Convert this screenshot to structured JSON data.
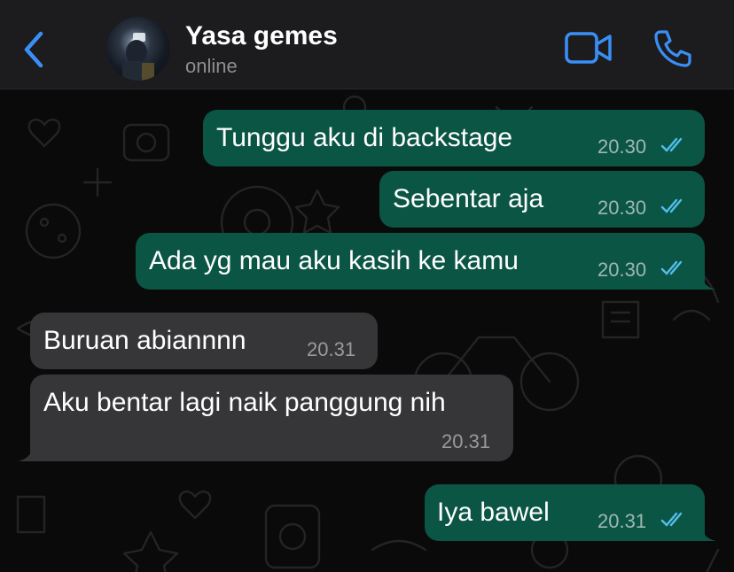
{
  "header": {
    "contact_name": "Yasa gemes",
    "status": "online",
    "back_icon": "chevron-left-icon",
    "video_icon": "video-camera-icon",
    "call_icon": "phone-icon",
    "accent_color": "#3a8ff7"
  },
  "messages": [
    {
      "direction": "outgoing",
      "text": "Tunggu aku di backstage",
      "time": "20.30",
      "read": true
    },
    {
      "direction": "outgoing",
      "text": "Sebentar aja",
      "time": "20.30",
      "read": true
    },
    {
      "direction": "outgoing",
      "text": "Ada yg mau aku kasih ke kamu",
      "time": "20.30",
      "read": true
    },
    {
      "direction": "incoming",
      "text": "Buruan abiannnn",
      "time": "20.31"
    },
    {
      "direction": "incoming",
      "text": "Aku bentar lagi naik panggung nih",
      "time": "20.31"
    },
    {
      "direction": "outgoing",
      "text": "Iya bawel",
      "time": "20.31",
      "read": true
    }
  ],
  "colors": {
    "outgoing_bubble": "#0b5545",
    "incoming_bubble": "#363638",
    "read_ticks": "#53bdeb"
  }
}
